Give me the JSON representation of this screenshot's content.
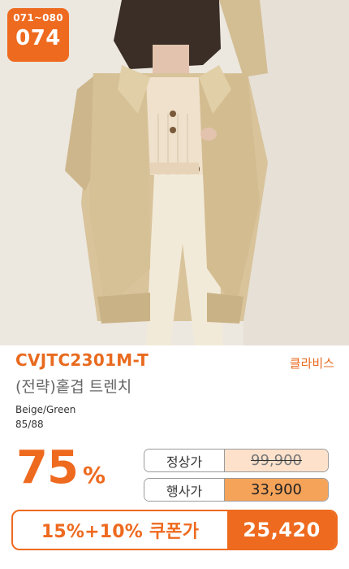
{
  "badge": {
    "range": "071~080",
    "number": "074"
  },
  "product": {
    "code": "CVJTC2301M-T",
    "brand": "클라비스",
    "name": "(전략)홑겹 트렌치",
    "color": "Beige/Green",
    "size": "85/88"
  },
  "pricing": {
    "discount_percent": "75",
    "percent_sign": "%",
    "normal_label": "정상가",
    "normal_price": "99,900",
    "event_label": "행사가",
    "event_price": "33,900",
    "coupon_label": "15%+10% 쿠폰가",
    "coupon_price": "25,420"
  },
  "colors": {
    "accent": "#ee6a1f",
    "normal_price_bg": "#fde1cb",
    "event_price_bg": "#f6a35a"
  },
  "image": {
    "subject": "model wearing beige trench coat with cream knit and white pants"
  }
}
